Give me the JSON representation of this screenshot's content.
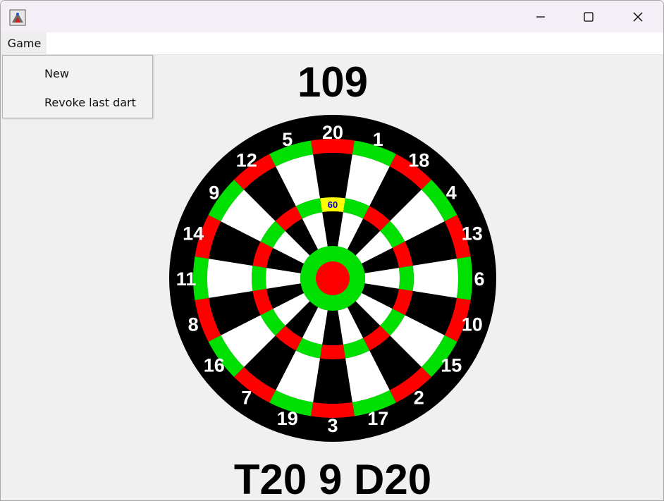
{
  "window": {
    "title": ""
  },
  "menu": {
    "game_label": "Game",
    "items": [
      {
        "label": "New"
      },
      {
        "label": "Revoke last dart"
      }
    ]
  },
  "score": {
    "remaining": "109"
  },
  "last_darts": {
    "text": "T20 9 D20"
  },
  "board": {
    "numbers": [
      20,
      1,
      18,
      4,
      13,
      6,
      10,
      15,
      2,
      17,
      3,
      19,
      7,
      16,
      8,
      11,
      14,
      9,
      12,
      5
    ],
    "highlighted_segment": {
      "number": 20,
      "ring": "triple",
      "label": "60"
    },
    "colors": {
      "background": "#000000",
      "red": "#ff0000",
      "green": "#00e000",
      "white": "#ffffff",
      "black": "#000000",
      "highlight": "#ffff00",
      "highlight_text": "#0000cc",
      "number_text": "#ffffff"
    }
  }
}
